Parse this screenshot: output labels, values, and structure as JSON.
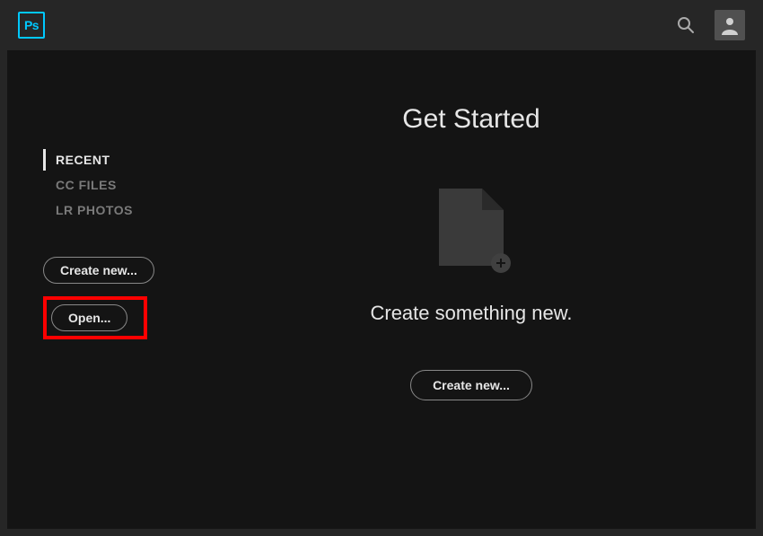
{
  "logo": {
    "text": "Ps"
  },
  "sidebar": {
    "items": [
      {
        "label": "RECENT",
        "active": true
      },
      {
        "label": "CC FILES",
        "active": false
      },
      {
        "label": "LR PHOTOS",
        "active": false
      }
    ],
    "create_label": "Create new...",
    "open_label": "Open..."
  },
  "main": {
    "title": "Get Started",
    "subtitle": "Create something new.",
    "create_label": "Create new..."
  },
  "highlight": {
    "target": "open-button"
  }
}
